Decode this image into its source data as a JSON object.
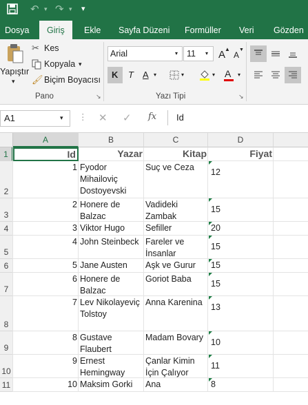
{
  "title_bar": {
    "undo_glyph": "↶",
    "redo_glyph": "↷",
    "customize_glyph": "▾"
  },
  "tabs": [
    "Dosya",
    "Giriş",
    "Ekle",
    "Sayfa Düzeni",
    "Formüller",
    "Veri",
    "Gözden"
  ],
  "ribbon": {
    "paste_label": "Yapıştır",
    "cut_label": "Kes",
    "copy_label": "Kopyala",
    "format_painter_label": "Biçim Boyacısı",
    "clipboard_group": "Pano",
    "font_name": "Arial",
    "font_size": "11",
    "grow_font": "A",
    "shrink_font": "A",
    "bold": "K",
    "italic": "T",
    "underline": "A",
    "font_color_letter": "A",
    "font_group": "Yazı Tipi"
  },
  "formula_bar": {
    "name_box": "A1",
    "fx": "fx",
    "content": "Id"
  },
  "columns": [
    "A",
    "B",
    "C",
    "D"
  ],
  "rows": [
    "1",
    "2",
    "3",
    "4",
    "5",
    "6",
    "7",
    "8",
    "9",
    "10",
    "11"
  ],
  "header": {
    "id": "Id",
    "yazar": "Yazar",
    "kitap": "Kitap",
    "fiyat": "Fiyat"
  },
  "records": [
    {
      "id": "1",
      "yazar": [
        "Fyodor",
        "Mihailoviç",
        "Dostoyevski"
      ],
      "kitap": [
        "Suç ve Ceza"
      ],
      "fiyat": "12"
    },
    {
      "id": "2",
      "yazar": [
        "Honere de",
        "Balzac"
      ],
      "kitap": [
        "Vadideki",
        "Zambak"
      ],
      "fiyat": "15"
    },
    {
      "id": "3",
      "yazar": [
        "Viktor Hugo"
      ],
      "kitap": [
        "Sefiller"
      ],
      "fiyat": "20"
    },
    {
      "id": "4",
      "yazar": [
        "John Steinbeck"
      ],
      "kitap": [
        "Fareler ve",
        "İnsanlar"
      ],
      "fiyat": "15"
    },
    {
      "id": "5",
      "yazar": [
        "Jane Austen"
      ],
      "kitap": [
        "Aşk ve Gurur"
      ],
      "fiyat": "15"
    },
    {
      "id": "6",
      "yazar": [
        "Honere de",
        "Balzac"
      ],
      "kitap": [
        "Goriot Baba"
      ],
      "fiyat": "15"
    },
    {
      "id": "7",
      "yazar": [
        "Lev Nikolayeviç",
        "Tolstoy"
      ],
      "kitap": [
        "Anna Karenina"
      ],
      "fiyat": "13"
    },
    {
      "id": "8",
      "yazar": [
        "Gustave",
        "Flaubert"
      ],
      "kitap": [
        "Madam Bovary"
      ],
      "fiyat": "10"
    },
    {
      "id": "9",
      "yazar": [
        "Ernest",
        "Hemingway"
      ],
      "kitap": [
        "Çanlar Kimin",
        "İçin Çalıyor"
      ],
      "fiyat": "11"
    },
    {
      "id": "10",
      "yazar": [
        "Maksim Gorki"
      ],
      "kitap": [
        "Ana"
      ],
      "fiyat": "8"
    }
  ]
}
